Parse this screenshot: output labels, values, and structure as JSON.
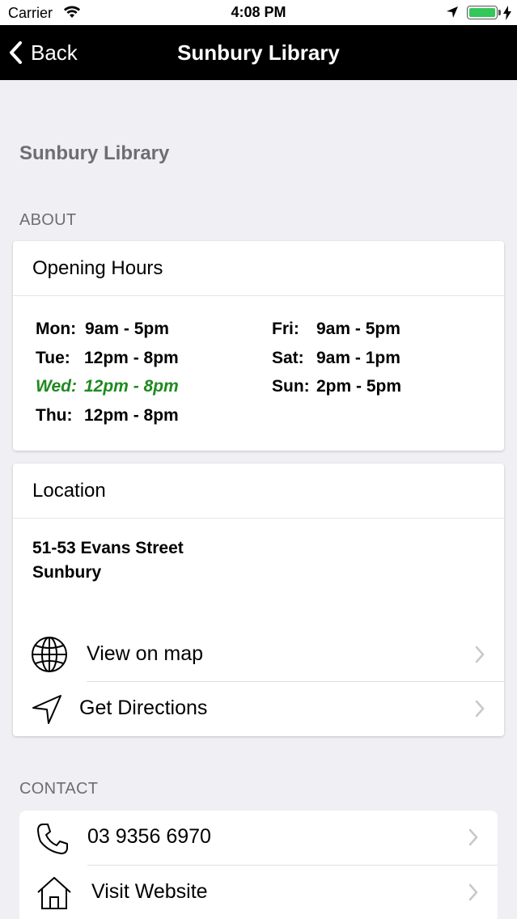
{
  "status": {
    "carrier": "Carrier",
    "time": "4:08 PM",
    "battery_level": 1.0
  },
  "nav": {
    "back_label": "Back",
    "title": "Sunbury Library"
  },
  "page": {
    "title": "Sunbury Library"
  },
  "about": {
    "section_label": "ABOUT",
    "hours_title": "Opening Hours",
    "hours": [
      {
        "day": "Mon:",
        "time": "9am - 5pm",
        "today": false
      },
      {
        "day": "Tue:",
        "time": "12pm - 8pm",
        "today": false
      },
      {
        "day": "Wed:",
        "time": "12pm - 8pm",
        "today": true
      },
      {
        "day": "Thu:",
        "time": "12pm - 8pm",
        "today": false
      },
      {
        "day": "Fri:",
        "time": "9am - 5pm",
        "today": false
      },
      {
        "day": "Sat:",
        "time": "9am - 1pm",
        "today": false
      },
      {
        "day": "Sun:",
        "time": "2pm - 5pm",
        "today": false
      }
    ],
    "today_color": "#1e8a1e"
  },
  "location": {
    "title": "Location",
    "address_line1": "51-53 Evans Street",
    "address_line2": "Sunbury",
    "view_map_label": "View on map",
    "directions_label": "Get Directions"
  },
  "contact": {
    "section_label": "CONTACT",
    "phone": "03 9356 6970",
    "website_label": "Visit Website"
  }
}
